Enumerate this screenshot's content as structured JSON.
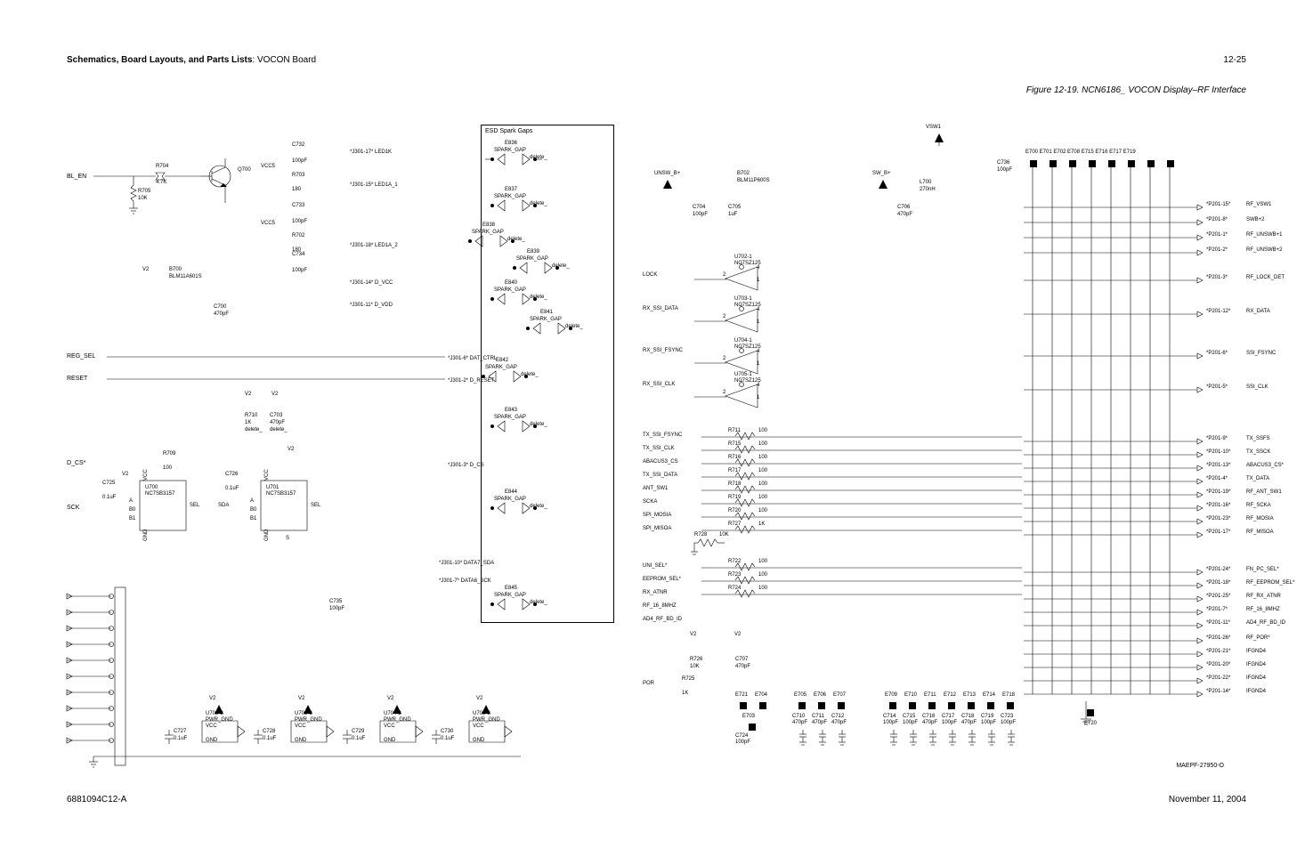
{
  "header_prefix": "Schematics, Board Layouts, and Parts Lists",
  "header_suffix": ": VOCON Board",
  "pagenum": "12-25",
  "figtitle": "Figure 12-19. NCN6186_ VOCON Display–RF Interface",
  "footer_left": "6881094C12-A",
  "footer_right": "November 11, 2004",
  "maepf": "MAEPF-27950-O",
  "esd_label": "ESD Spark Gaps",
  "left_ports": {
    "bl_en": "BL_EN",
    "reg_sel": "REG_SEL",
    "reset": "RESET",
    "d_cs": "D_CS*",
    "sck": "SCK"
  },
  "left_components": {
    "r704": {
      "ref": "R704",
      "val": "4.7K"
    },
    "r705": {
      "ref": "R705",
      "val": "10K"
    },
    "q700": "Q700",
    "vcc5": "VCC5",
    "r703": {
      "ref": "R703",
      "val": "180"
    },
    "r702": {
      "ref": "R702",
      "val": "180"
    },
    "c732": {
      "ref": "C732",
      "val": "100pF"
    },
    "c733": {
      "ref": "C733",
      "val": "100pF"
    },
    "c734": {
      "ref": "C734",
      "val": "100pF"
    },
    "c700": {
      "ref": "C700",
      "val": "470pF"
    },
    "b700": {
      "ref": "B700",
      "val": "BLM11A601S"
    },
    "v2": "V2",
    "r710": {
      "ref": "R710",
      "val": "1K",
      "note": "delete_"
    },
    "c703": {
      "ref": "C703",
      "val": "470pF",
      "note": "delete_"
    },
    "r709": {
      "ref": "R709",
      "val": "100"
    },
    "c725": {
      "ref": "C725",
      "val": "0.1uF"
    },
    "c726": {
      "ref": "C726",
      "val": "0.1uF"
    },
    "u700": {
      "ref": "U700",
      "val": "NC7SB3157"
    },
    "u701": {
      "ref": "U701",
      "val": "NC7SB3157"
    },
    "sel": "SEL",
    "sda": "SDA",
    "a": "A",
    "b0": "B0",
    "b1": "B1",
    "vcc": "VCC",
    "gnd": "GND",
    "s": "S",
    "c735": {
      "ref": "C735",
      "val": "100pF"
    },
    "c727": {
      "ref": "C727",
      "val": "0.1uF"
    },
    "c728": {
      "ref": "C728",
      "val": "0.1uF"
    },
    "c729": {
      "ref": "C729",
      "val": "0.1uF"
    },
    "c730": {
      "ref": "C730",
      "val": "0.1uF"
    },
    "u702_2": {
      "ref": "U702-2",
      "val": "PWR_GND"
    },
    "u703_2": {
      "ref": "U703-2",
      "val": "PWR_GND"
    },
    "u704_2": {
      "ref": "U704-2",
      "val": "PWR_GND"
    },
    "u705_2": {
      "ref": "U705-2",
      "val": "PWR_GND"
    }
  },
  "jlabels": {
    "j17": "*J301-17*  LED1K",
    "j15": "*J301-15*  LED1A_1",
    "j18": "*J301-18*  LED1A_2",
    "j14": "*J301-14*  D_VCC",
    "j11": "*J301-11*  D_VDD",
    "j6": "*J301-6*    DAT_CTRL",
    "j2": "*J301-2*    D_RESET",
    "j3": "*J301-3*    D_CS",
    "j10": "*J301-10*  DATA7_SDA",
    "j7": "*J301-7*    DATA6_SCK"
  },
  "spark_gaps": {
    "e836": "E836",
    "e837": "E837",
    "e838": "E838",
    "e839": "E839",
    "e840": "E840",
    "e841": "E841",
    "e842": "E842",
    "e843": "E843",
    "e844": "E844",
    "e845": "E845",
    "label": "SPARK_GAP",
    "delete": "delete_"
  },
  "right_rails": {
    "vsw1": "VSW1",
    "unsw_b": "UNSW_B+",
    "sw_b": "SW_B+",
    "b702": {
      "ref": "B702",
      "val": "BLM11P600S"
    },
    "l700": {
      "ref": "L700",
      "val": "270nH"
    },
    "c704": {
      "ref": "C704",
      "val": "100pF"
    },
    "c705": {
      "ref": "C705",
      "val": "1uF"
    },
    "c706": {
      "ref": "C706",
      "val": "470pF"
    },
    "c736": {
      "ref": "C736",
      "val": "100pF"
    }
  },
  "u_bufs": {
    "u702_1": {
      "ref": "U702-1",
      "val": "NC7SZ125"
    },
    "u703_1": {
      "ref": "U703-1",
      "val": "NC7SZ125"
    },
    "u704_1": {
      "ref": "U704-1",
      "val": "NC7SZ125"
    },
    "u705_1": {
      "ref": "U705-1",
      "val": "NC7SZ125"
    }
  },
  "mid_ports": {
    "lock": "LOCK",
    "rx_ssi_data": "RX_SSI_DATA",
    "rx_ssi_fsync": "RX_SSI_FSYNC",
    "rx_ssi_clk": "RX_SSI_CLK",
    "tx_ssi_fsync": "TX_SSI_FSYNC",
    "tx_ssi_clk": "TX_SSI_CLK",
    "abacus3_cs": "ABACUS3_CS",
    "tx_ssi_data": "TX_SSI_DATA",
    "ant_sw1": "ANT_SW1",
    "scka": "SCKA",
    "spi_mosia": "SPI_MOSIA",
    "spi_misoa": "SPI_MISOA",
    "uni_sel": "UNI_SEL*",
    "eeprom_sel": "EEPROM_SEL*",
    "rx_atnr": "RX_ATNR",
    "rf_16_8mhz": "RF_16_8MHZ",
    "ad4_rf_bd_id": "AD4_RF_BD_ID",
    "por": "POR"
  },
  "mid_resistors": {
    "r711": {
      "ref": "R711",
      "val": "100"
    },
    "r715": {
      "ref": "R715",
      "val": "100"
    },
    "r716": {
      "ref": "R716",
      "val": "100"
    },
    "r717": {
      "ref": "R717",
      "val": "100"
    },
    "r718": {
      "ref": "R718",
      "val": "100"
    },
    "r719": {
      "ref": "R719",
      "val": "100"
    },
    "r720": {
      "ref": "R720",
      "val": "100"
    },
    "r727": {
      "ref": "R727",
      "val": "1K"
    },
    "r728": {
      "ref": "R728",
      "val": "10K"
    },
    "r722": {
      "ref": "R722",
      "val": "100"
    },
    "r723": {
      "ref": "R723",
      "val": "100"
    },
    "r724": {
      "ref": "R724",
      "val": "100"
    },
    "r725": {
      "ref": "R725",
      "val": "1K"
    },
    "r726": {
      "ref": "R726",
      "val": "10K"
    },
    "c707": {
      "ref": "C707",
      "val": "470pF"
    }
  },
  "e_pads_row": [
    "E700",
    "E701",
    "E702",
    "E708",
    "E715",
    "E716",
    "E717",
    "E719"
  ],
  "bottom_caps": {
    "e721": "E721",
    "e704": "E704",
    "e703": "E703",
    "c724": {
      "ref": "C724",
      "val": "100pF"
    },
    "e705": "E705",
    "e706": "E706",
    "e707": "E707",
    "c710": {
      "ref": "C710",
      "val": "470pF"
    },
    "c711": {
      "ref": "C711",
      "val": "470pF"
    },
    "c712": {
      "ref": "C712",
      "val": "470pF"
    },
    "e709": "E709",
    "e710": "E710",
    "e711": "E711",
    "e712": "E712",
    "e713": "E713",
    "e714": "E714",
    "e718": "E718",
    "c714": {
      "ref": "C714",
      "val": "100pF"
    },
    "c715": {
      "ref": "C715",
      "val": "100pF"
    },
    "c716": {
      "ref": "C716",
      "val": "470pF"
    },
    "c717": {
      "ref": "C717",
      "val": "100pF"
    },
    "c718": {
      "ref": "C718",
      "val": "470pF"
    },
    "c719": {
      "ref": "C719",
      "val": "100pF"
    },
    "c723": {
      "ref": "C723",
      "val": "100pF"
    },
    "e720": "E720"
  },
  "p201": [
    {
      "pin": "*P201-15*",
      "name": "RF_VSW1"
    },
    {
      "pin": "*P201-8*",
      "name": "SWB+2"
    },
    {
      "pin": "*P201-1*",
      "name": "RF_UNSWB+1"
    },
    {
      "pin": "*P201-2*",
      "name": "RF_UNSWB+2"
    },
    {
      "pin": "*P201-3*",
      "name": "RF_LOCK_DET"
    },
    {
      "pin": "*P201-12*",
      "name": "RX_DATA"
    },
    {
      "pin": "*P201-6*",
      "name": "SSI_FSYNC"
    },
    {
      "pin": "*P201-5*",
      "name": "SSI_CLK"
    },
    {
      "pin": "*P201-9*",
      "name": "TX_SSFS"
    },
    {
      "pin": "*P201-10*",
      "name": "TX_SSCK"
    },
    {
      "pin": "*P201-13*",
      "name": "ABACUS3_CS*"
    },
    {
      "pin": "*P201-4*",
      "name": "TX_DATA"
    },
    {
      "pin": "*P201-19*",
      "name": "RF_ANT_SW1"
    },
    {
      "pin": "*P201-16*",
      "name": "RF_SCKA"
    },
    {
      "pin": "*P201-23*",
      "name": "RF_MOSIA"
    },
    {
      "pin": "*P201-17*",
      "name": "RF_MISOA"
    },
    {
      "pin": "*P201-24*",
      "name": "FN_PC_SEL*"
    },
    {
      "pin": "*P201-18*",
      "name": "RF_EEPROM_SEL*"
    },
    {
      "pin": "*P201-25*",
      "name": "RF_RX_ATNR"
    },
    {
      "pin": "*P201-7*",
      "name": "RF_16_8MHZ"
    },
    {
      "pin": "*P201-11*",
      "name": "AD4_RF_BD_ID"
    },
    {
      "pin": "*P201-26*",
      "name": "RF_POR*"
    },
    {
      "pin": "*P201-21*",
      "name": "IFGND4"
    },
    {
      "pin": "*P201-20*",
      "name": "IFGND4"
    },
    {
      "pin": "*P201-22*",
      "name": "IFGND4"
    },
    {
      "pin": "*P201-14*",
      "name": "IFGND4"
    }
  ],
  "p201_ys": [
    227,
    244,
    261,
    278,
    309,
    347,
    394,
    432,
    490,
    505,
    520,
    535,
    550,
    565,
    580,
    595,
    637,
    652,
    667,
    682,
    697,
    714,
    729,
    744,
    759,
    774
  ]
}
